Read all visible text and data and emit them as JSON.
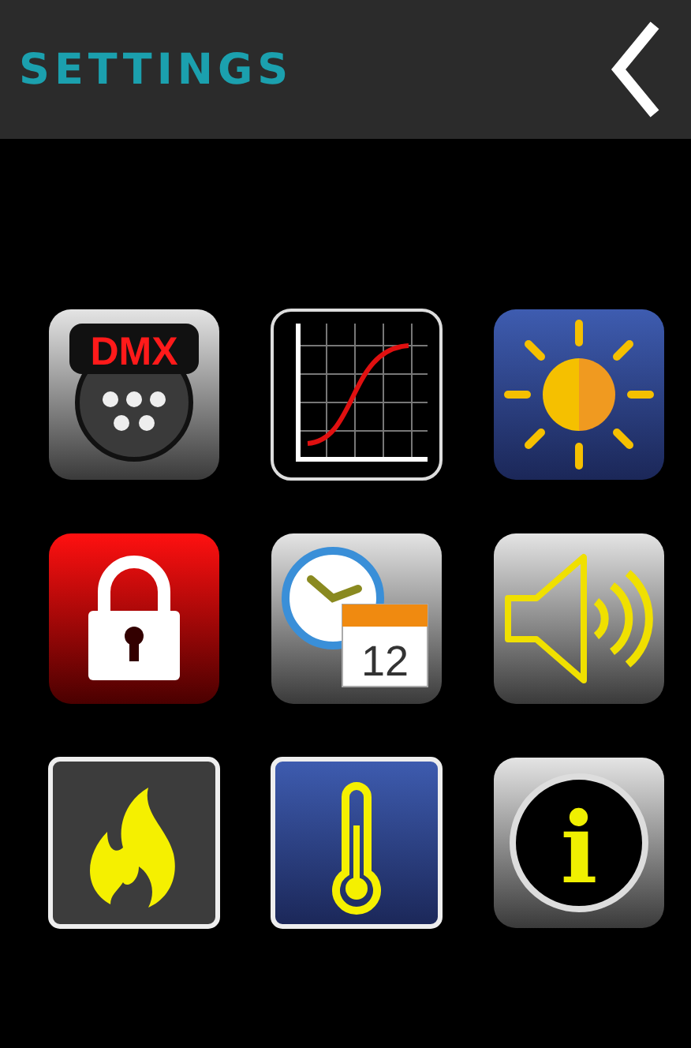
{
  "header": {
    "title": "SETTINGS"
  },
  "tiles": [
    {
      "kind": "dmx",
      "label": "DMX"
    },
    {
      "kind": "curve"
    },
    {
      "kind": "brightness"
    },
    {
      "kind": "lock"
    },
    {
      "kind": "schedule",
      "label": "12"
    },
    {
      "kind": "volume"
    },
    {
      "kind": "fire"
    },
    {
      "kind": "temperature"
    },
    {
      "kind": "info",
      "label": "i"
    }
  ]
}
